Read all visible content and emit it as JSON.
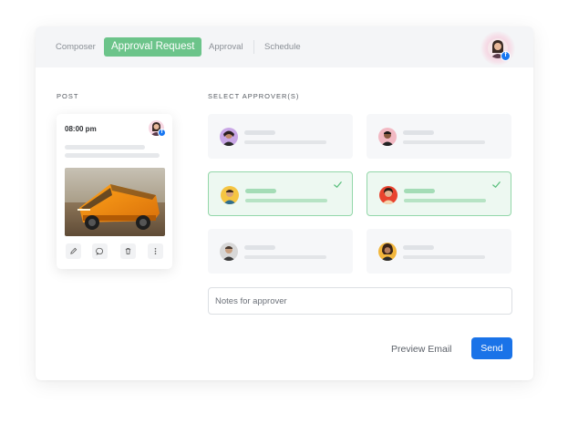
{
  "tabs": {
    "composer": "Composer",
    "approval_request": "Approval Request",
    "approval": "Approval",
    "schedule": "Schedule"
  },
  "header": {
    "avatar_icon": "user-avatar",
    "badge_icon": "facebook-icon"
  },
  "post": {
    "section_label": "POST",
    "time": "08:00 pm",
    "image_icon": "car-photo",
    "actions": [
      "edit-icon",
      "comment-icon",
      "delete-icon",
      "more-icon"
    ]
  },
  "approvers": {
    "section_label": "SELECT APPROVER(S)",
    "items": [
      {
        "selected": false
      },
      {
        "selected": false
      },
      {
        "selected": true
      },
      {
        "selected": true
      },
      {
        "selected": false
      },
      {
        "selected": false
      }
    ]
  },
  "notes": {
    "placeholder": "Notes for approver",
    "value": ""
  },
  "footer": {
    "preview_label": "Preview Email",
    "send_label": "Send"
  },
  "colors": {
    "accent_green": "#6cc48a",
    "send_blue": "#1a73e8",
    "facebook_blue": "#1877f2"
  }
}
